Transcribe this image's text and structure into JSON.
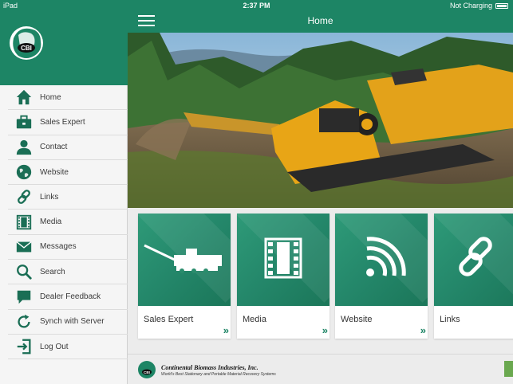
{
  "status": {
    "device": "iPad",
    "time": "2:37 PM",
    "charging": "Not Charging"
  },
  "header": {
    "title": "Home"
  },
  "brand": {
    "logo_text": "CBI",
    "color": "#1d8565"
  },
  "sidebar": {
    "items": [
      {
        "label": "Home",
        "icon": "home-icon"
      },
      {
        "label": "Sales Expert",
        "icon": "briefcase-icon"
      },
      {
        "label": "Contact",
        "icon": "person-icon"
      },
      {
        "label": "Website",
        "icon": "globe-icon"
      },
      {
        "label": "Links",
        "icon": "link-icon"
      },
      {
        "label": "Media",
        "icon": "film-icon"
      },
      {
        "label": "Messages",
        "icon": "envelope-icon"
      },
      {
        "label": "Search",
        "icon": "search-icon"
      },
      {
        "label": "Dealer Feedback",
        "icon": "speech-bubble-icon"
      },
      {
        "label": "Synch with Server",
        "icon": "refresh-icon"
      },
      {
        "label": "Log Out",
        "icon": "logout-icon"
      }
    ]
  },
  "tiles": [
    {
      "label": "Sales Expert",
      "icon": "machine-icon",
      "chevron": "»"
    },
    {
      "label": "Media",
      "icon": "film-icon",
      "chevron": "»"
    },
    {
      "label": "Website",
      "icon": "wifi-icon",
      "chevron": "»"
    },
    {
      "label": "Links",
      "icon": "link-icon",
      "chevron": "»"
    }
  ],
  "footer": {
    "company": "Continental Biomass Industries, Inc.",
    "tagline": "World's Best Stationary and Portable Material Recovery Systems",
    "logo_text": "CBI"
  }
}
